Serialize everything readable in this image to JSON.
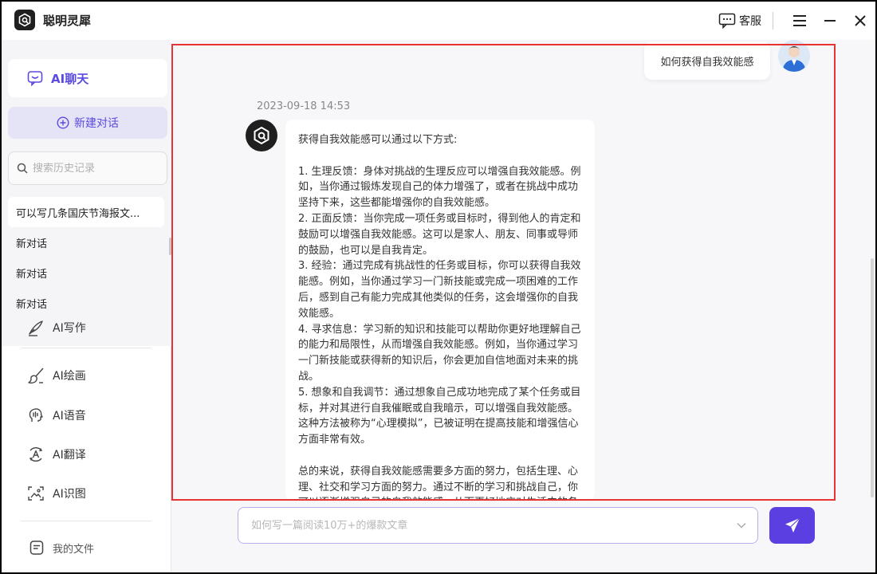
{
  "app": {
    "title": "聪明灵犀"
  },
  "titlebar": {
    "customer_service": "客服"
  },
  "sidebar": {
    "nav_chat": "AI聊天",
    "new_chat": "新建对话",
    "search_placeholder": "搜索历史记录",
    "history": [
      "可以写几条国庆节海报文...",
      "新对话",
      "新对话",
      "新对话"
    ],
    "tools": [
      "AI写作",
      "AI绘画",
      "AI语音",
      "AI翻译",
      "AI识图"
    ],
    "my_files": "我的文件"
  },
  "chat": {
    "user_message": "如何获得自我效能感",
    "timestamp": "2023-09-18 14:53",
    "bot_intro": "获得自我效能感可以通过以下方式:",
    "bot_points": [
      "1. 生理反馈：身体对挑战的生理反应可以增强自我效能感。例如，当你通过锻炼发现自己的体力增强了，或者在挑战中成功坚持下来，这些都能增强你的自我效能感。",
      "2. 正面反馈：当你完成一项任务或目标时，得到他人的肯定和鼓励可以增强自我效能感。这可以是家人、朋友、同事或导师的鼓励，也可以是自我肯定。",
      "3. 经验：通过完成有挑战性的任务或目标，你可以获得自我效能感。例如，当你通过学习一门新技能或完成一项困难的工作后，感到自己有能力完成其他类似的任务，这会增强你的自我效能感。",
      "4. 寻求信息：学习新的知识和技能可以帮助你更好地理解自己的能力和局限性，从而增强自我效能感。例如，当你通过学习一门新技能或获得新的知识后，你会更加自信地面对未来的挑战。",
      "5. 想象和自我调节：通过想象自己成功地完成了某个任务或目标，并对其进行自我催眠或自我暗示，可以增强自我效能感。这种方法被称为“心理模拟”，已被证明在提高技能和增强信心方面非常有效。"
    ],
    "bot_summary": "总的来说，获得自我效能感需要多方面的努力，包括生理、心理、社交和学习方面的努力。通过不断的学习和挑战自己，你可以逐渐增强自己的自我效能感，从而更好地应对生活中的各种挑战。"
  },
  "input": {
    "placeholder": "如何写一篇阅读10万+的爆款文章"
  },
  "colors": {
    "accent": "#5b3fe0",
    "highlight_border": "#e63333",
    "sidebar_bg": "#f5f5f8",
    "main_bg": "#f7f7f9"
  }
}
